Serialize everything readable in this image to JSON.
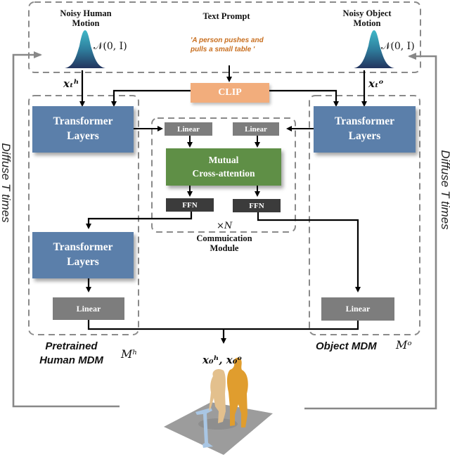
{
  "inputs": {
    "human_title": "Noisy Human\nMotion",
    "text_title": "Text Prompt",
    "object_title": "Noisy Object\nMotion",
    "human_dist": "𝒩(0, I)",
    "object_dist": "𝒩(0, I)",
    "prompt_line1": "'A person pushes and",
    "prompt_line2": "pulls  a small table '"
  },
  "variables": {
    "human_noisy": "xₜʰ",
    "object_noisy": "xₜᵒ",
    "output": "x₀ʰ, x₀ᵒ",
    "human_model": "Mʰ",
    "object_model": "Mᵒ",
    "repeat": "×N"
  },
  "blocks": {
    "clip": "CLIP",
    "transformer": "Transformer\nLayers",
    "linear": "Linear",
    "ffn": "FFN",
    "mutual": "Mutual\nCross-attention"
  },
  "modules": {
    "communication": "Commuication\nModule",
    "human_mdm": "Pretrained\nHuman MDM",
    "object_mdm": "Object MDM"
  },
  "side_labels": {
    "left": "Diffuse T times",
    "right": "Diffuse T times"
  },
  "colors": {
    "transformer": "#5b7faa",
    "linear": "#7d7d7d",
    "ffn": "#3b3b3b",
    "mutual": "#5f8f46",
    "clip": "#f2ad7c",
    "prompt_text": "#c86e1e",
    "gaussian_top": "#3fb8c8",
    "gaussian_bottom": "#23345e"
  }
}
